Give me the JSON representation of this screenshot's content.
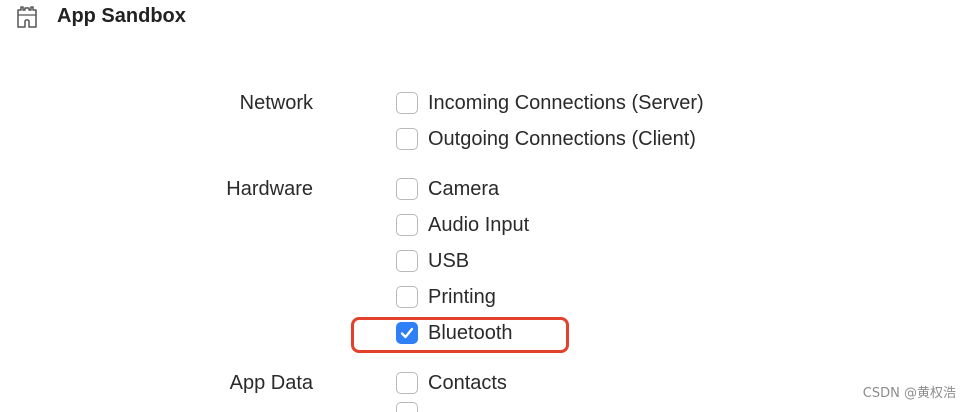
{
  "header": {
    "title": "App Sandbox",
    "icon": "castle-icon"
  },
  "sections": [
    {
      "label": "Network",
      "options": [
        {
          "label": "Incoming Connections (Server)",
          "checked": false
        },
        {
          "label": "Outgoing Connections (Client)",
          "checked": false
        }
      ]
    },
    {
      "label": "Hardware",
      "options": [
        {
          "label": "Camera",
          "checked": false
        },
        {
          "label": "Audio Input",
          "checked": false
        },
        {
          "label": "USB",
          "checked": false
        },
        {
          "label": "Printing",
          "checked": false
        },
        {
          "label": "Bluetooth",
          "checked": true
        }
      ]
    },
    {
      "label": "App Data",
      "options": [
        {
          "label": "Contacts",
          "checked": false
        }
      ]
    }
  ],
  "watermark": "CSDN @黄权浩",
  "colors": {
    "accent": "#2f7ff6",
    "highlight": "#e2422b"
  }
}
